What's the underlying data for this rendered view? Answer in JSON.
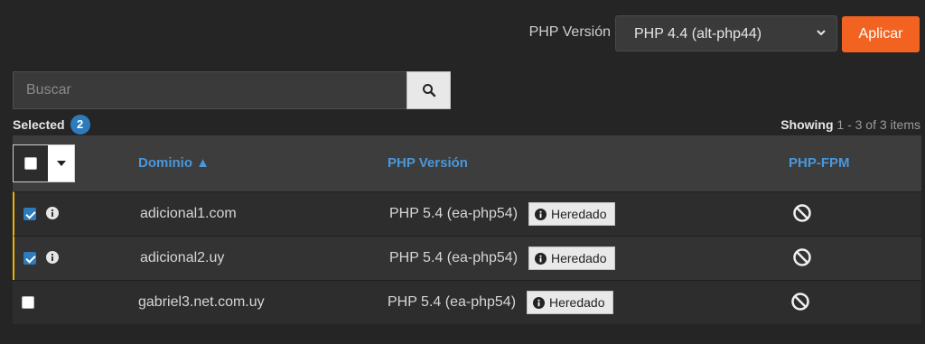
{
  "toolbar": {
    "php_version_label": "PHP Versión",
    "php_version_selected": "PHP 4.4 (alt-php44)",
    "apply_label": "Aplicar"
  },
  "search": {
    "placeholder": "Buscar"
  },
  "selection": {
    "label": "Selected",
    "count": "2"
  },
  "pagination": {
    "showing_label": "Showing",
    "range": "1 - 3 of 3 items"
  },
  "table": {
    "headers": {
      "domain": "Dominio ▲",
      "php_version": "PHP Versión",
      "php_fpm": "PHP-FPM"
    },
    "rows": [
      {
        "domain": "adicional1.com",
        "version": "PHP 5.4 (ea-php54)",
        "badge": "Heredado",
        "checked": true
      },
      {
        "domain": "adicional2.uy",
        "version": "PHP 5.4 (ea-php54)",
        "badge": "Heredado",
        "checked": true
      },
      {
        "domain": "gabriel3.net.com.uy",
        "version": "PHP 5.4 (ea-php54)",
        "badge": "Heredado",
        "checked": false
      }
    ]
  },
  "colors": {
    "accent": "#f26322",
    "link": "#4a97d9",
    "selected_bar": "#e8b400",
    "badge": "#2b7bbd"
  }
}
